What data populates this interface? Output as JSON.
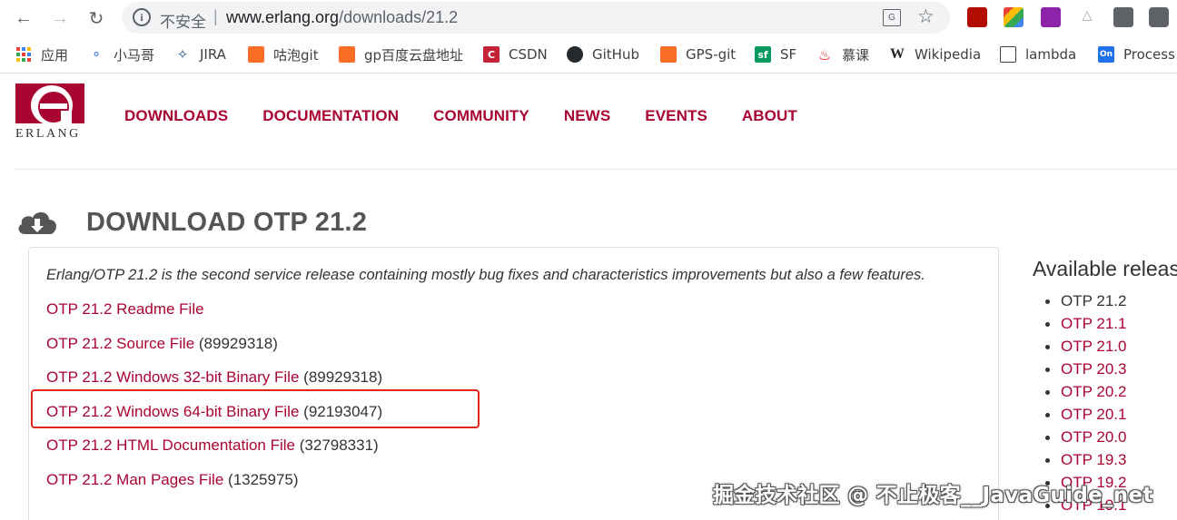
{
  "browser": {
    "security_label": "不安全",
    "url_host": "www.erlang.org",
    "url_path": "/downloads/21.2"
  },
  "bookmarks": [
    {
      "label": "应用",
      "icon": "apps-grid-icon"
    },
    {
      "label": "小马哥",
      "icon": "link-icon"
    },
    {
      "label": "JIRA",
      "icon": "jira-icon"
    },
    {
      "label": "咕泡git",
      "icon": "gitlab-icon"
    },
    {
      "label": "gp百度云盘地址",
      "icon": "gitlab-icon"
    },
    {
      "label": "CSDN",
      "icon": "csdn-icon"
    },
    {
      "label": "GitHub",
      "icon": "github-icon"
    },
    {
      "label": "GPS-git",
      "icon": "gitlab-icon"
    },
    {
      "label": "SF",
      "icon": "segmentfault-icon"
    },
    {
      "label": "慕课",
      "icon": "flame-icon"
    },
    {
      "label": "Wikipedia",
      "icon": "wikipedia-icon"
    },
    {
      "label": "lambda",
      "icon": "book-icon"
    },
    {
      "label": "Process",
      "icon": "processon-icon"
    }
  ],
  "site": {
    "logo_text": "ERLANG",
    "nav": [
      "DOWNLOADS",
      "DOCUMENTATION",
      "COMMUNITY",
      "NEWS",
      "EVENTS",
      "ABOUT"
    ]
  },
  "main": {
    "title": "DOWNLOAD OTP 21.2",
    "intro": "Erlang/OTP 21.2 is the second service release containing mostly bug fixes and characteristics improvements but also a few features.",
    "downloads": [
      {
        "label": "OTP 21.2 Readme File",
        "size": ""
      },
      {
        "label": "OTP 21.2 Source File",
        "size": "(89929318)"
      },
      {
        "label": "OTP 21.2 Windows 32-bit Binary File",
        "size": "(89929318)"
      },
      {
        "label": "OTP 21.2 Windows 64-bit Binary File",
        "size": "(92193047)"
      },
      {
        "label": "OTP 21.2 HTML Documentation File",
        "size": "(32798331)"
      },
      {
        "label": "OTP 21.2 Man Pages File",
        "size": "(1325975)"
      }
    ]
  },
  "sidebar": {
    "title": "Available releas",
    "releases": [
      "OTP 21.2",
      "OTP 21.1",
      "OTP 21.0",
      "OTP 20.3",
      "OTP 20.2",
      "OTP 20.1",
      "OTP 20.0",
      "OTP 19.3",
      "OTP 19.2",
      "OTP 19.1"
    ]
  },
  "watermark": "掘金技术社区 @ 不止极客__JavaGuide_net",
  "colors": {
    "brand": "#a90533",
    "highlight": "#e1251b"
  }
}
